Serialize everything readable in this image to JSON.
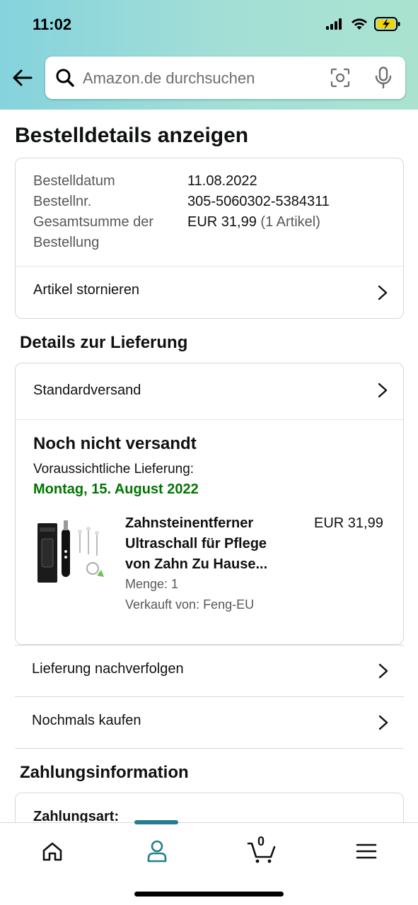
{
  "status_bar": {
    "time": "11:02"
  },
  "search": {
    "placeholder": "Amazon.de durchsuchen"
  },
  "page": {
    "title": "Bestelldetails anzeigen"
  },
  "order": {
    "date_label": "Bestelldatum",
    "date_value": "11.08.2022",
    "number_label": "Bestellnr.",
    "number_value": "305-5060302-5384311",
    "total_label_line1": "Gesamtsumme der",
    "total_label_line2": "Bestellung",
    "total_value": "EUR 31,99",
    "total_items": "(1 Artikel)",
    "cancel_label": "Artikel stornieren"
  },
  "delivery": {
    "section_title": "Details zur Lieferung",
    "shipping_method": "Standardversand",
    "status": "Noch nicht versandt",
    "eta_label": "Voraussichtliche Lieferung:",
    "eta_date": "Montag, 15. August 2022",
    "product": {
      "name": "Zahnsteinentferner Ultraschall für Pflege von Zahn Zu Hause...",
      "price": "EUR 31,99",
      "quantity": "Menge: 1",
      "seller": "Verkauft von: Feng-EU"
    },
    "track_label": "Lieferung nachverfolgen",
    "buy_again_label": "Nochmals kaufen"
  },
  "payment": {
    "section_title": "Zahlungsinformation",
    "method_label": "Zahlungsart:"
  },
  "bottom_nav": {
    "cart_count": "0",
    "active": "account",
    "accent_color": "#237e90"
  },
  "colors": {
    "delivery_green": "#007600",
    "header_gradient_start": "#85d3dd",
    "header_gradient_end": "#a9e3d0"
  }
}
